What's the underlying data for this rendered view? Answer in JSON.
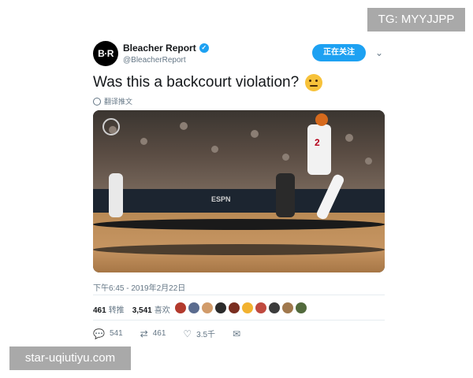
{
  "watermarks": {
    "top_right": "TG: MYYJJPP",
    "bottom_left": "star-uqiutiyu.com"
  },
  "author": {
    "avatar_text": "B·R",
    "name": "Bleacher Report",
    "handle": "@BleacherReport",
    "verified_icon": "verified-check-icon"
  },
  "header": {
    "follow_label": "正在关注",
    "menu_icon": "chevron-down-icon"
  },
  "tweet": {
    "text": "Was this a backcourt violation?",
    "emoji": "thinking-face-emoji",
    "translate_label": "翻译推文"
  },
  "media": {
    "player_number": "2",
    "ad_labels": [
      "ESPN"
    ]
  },
  "timestamp": "下午6:45 - 2019年2月22日",
  "stats": {
    "retweets_count": "461",
    "retweets_label": "转推",
    "likes_count": "3,541",
    "likes_label": "喜欢",
    "face_colors": [
      "#b33a2d",
      "#5b6c8f",
      "#d19b6a",
      "#2b2b2b",
      "#7a2e20",
      "#f2b230",
      "#c04a3f",
      "#3c3c3c",
      "#a0784d",
      "#526a3c"
    ]
  },
  "actions": {
    "reply_count": "541",
    "retweet_count": "461",
    "like_count": "3.5千",
    "reply_icon": "reply-icon",
    "retweet_icon": "retweet-icon",
    "like_icon": "heart-icon",
    "message_icon": "message-icon"
  }
}
